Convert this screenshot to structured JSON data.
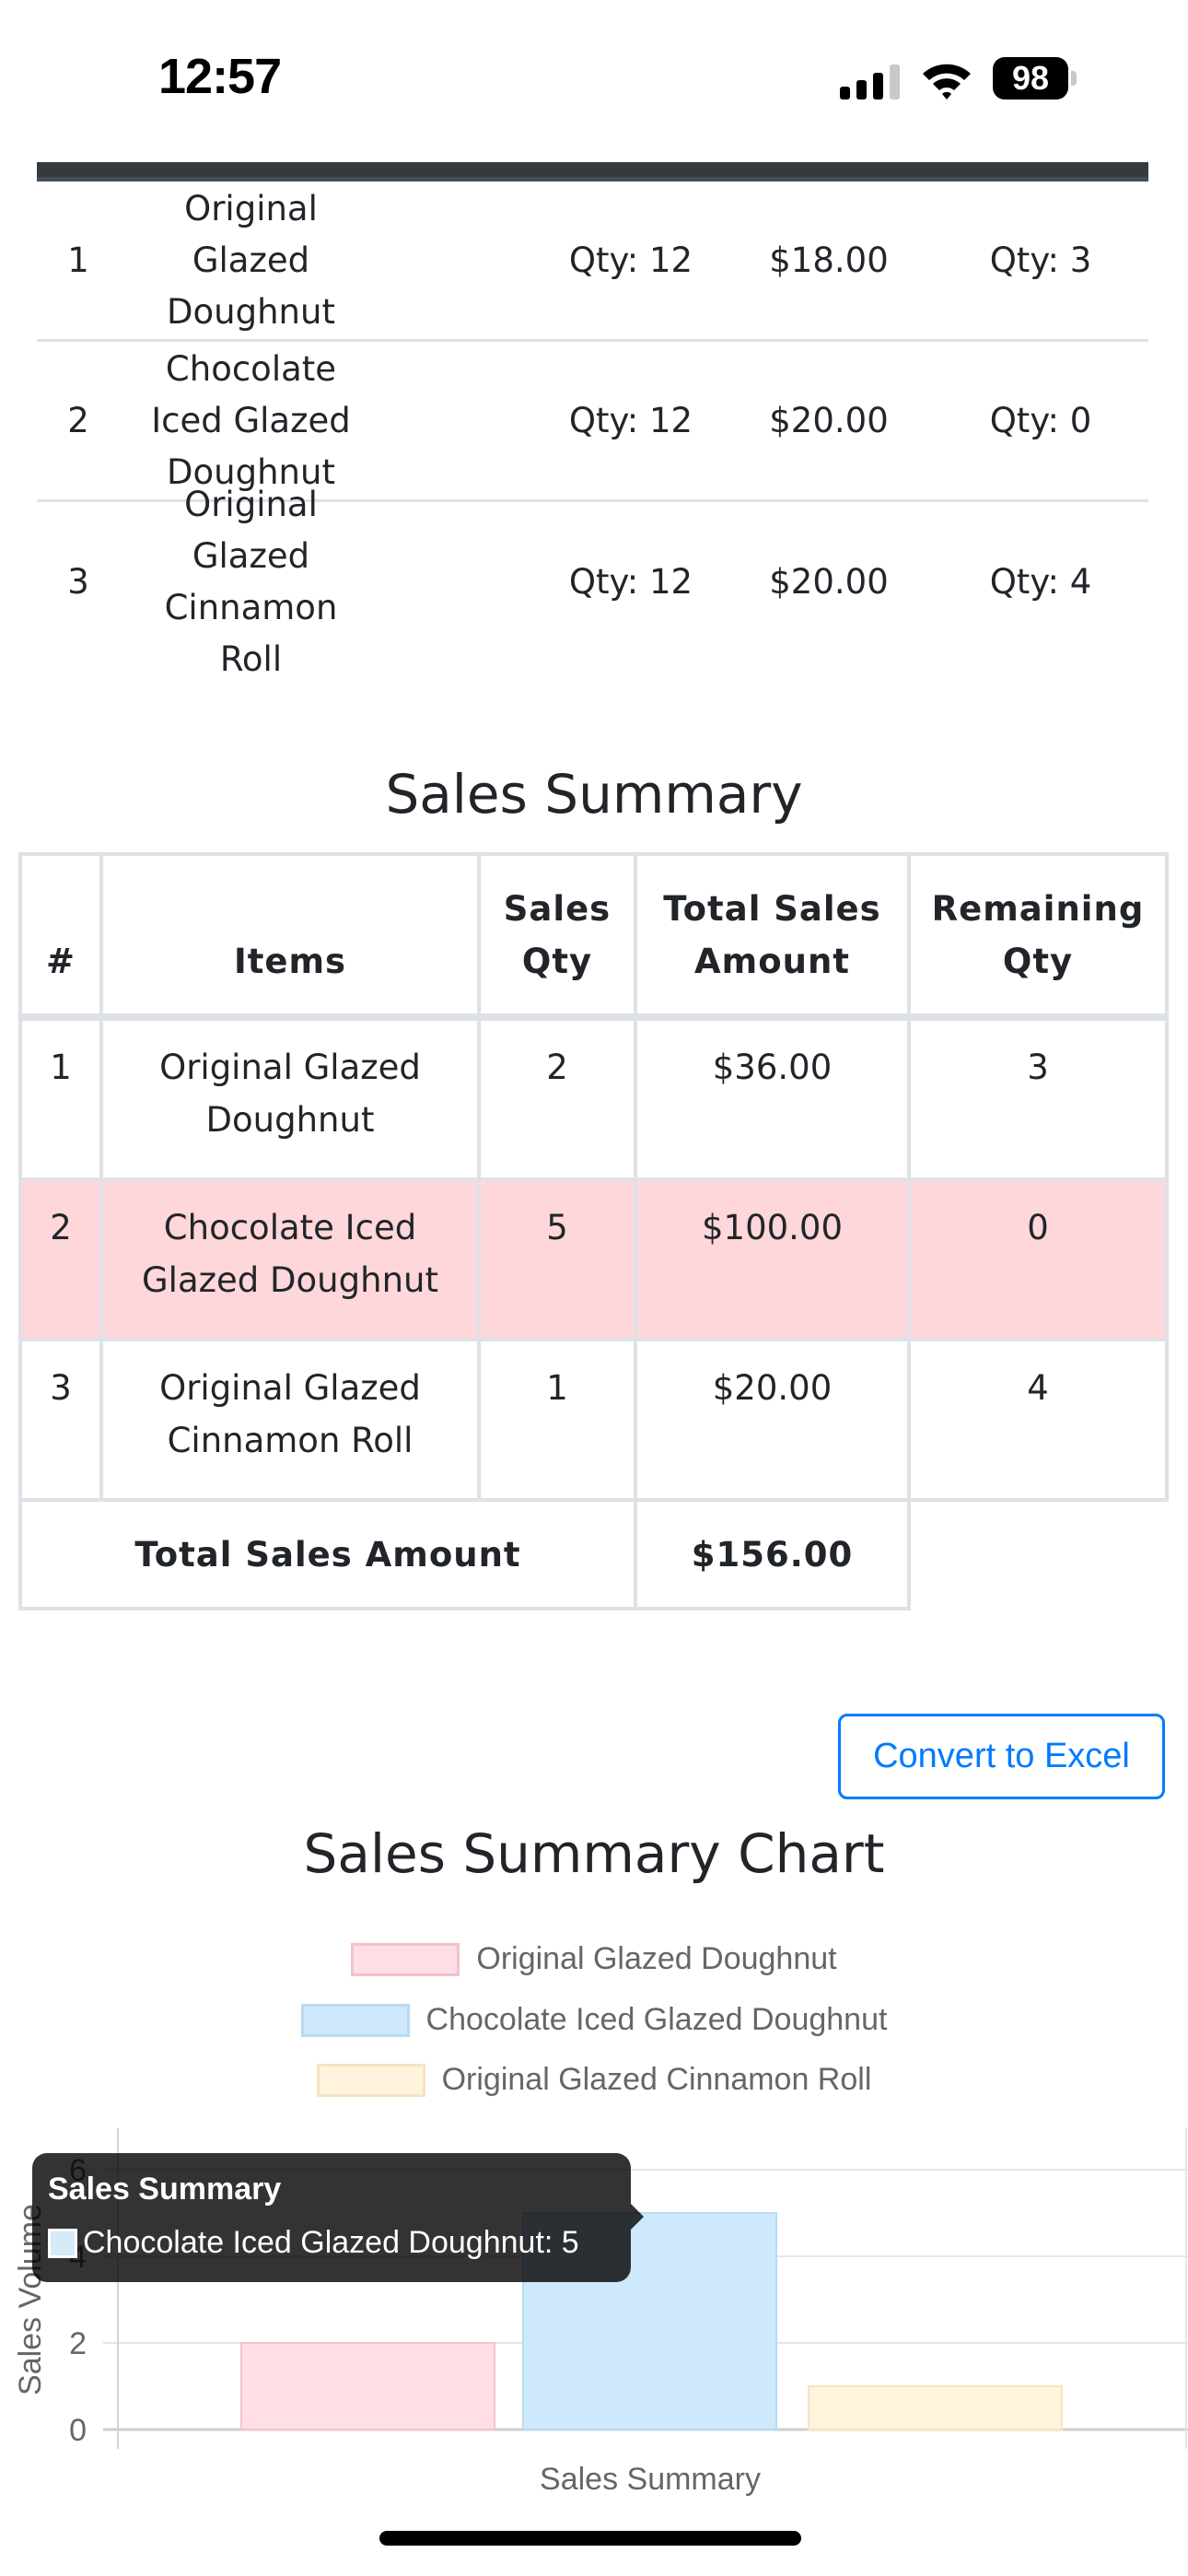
{
  "status_bar": {
    "time": "12:57",
    "battery_level": "98",
    "icons": [
      "cellular-signal-icon",
      "wifi-icon",
      "battery-icon"
    ]
  },
  "inventory_table": {
    "rows": [
      {
        "index": "1",
        "item": "Original Glazed Doughnut",
        "stock": "Qty: 12",
        "price": "$18.00",
        "remaining": "Qty: 3"
      },
      {
        "index": "2",
        "item": "Chocolate Iced Glazed Doughnut",
        "stock": "Qty: 12",
        "price": "$20.00",
        "remaining": "Qty: 0"
      },
      {
        "index": "3",
        "item": "Original Glazed Cinnamon Roll",
        "stock": "Qty: 12",
        "price": "$20.00",
        "remaining": "Qty: 4"
      }
    ]
  },
  "sales_summary": {
    "title": "Sales Summary",
    "headers": [
      "#",
      "Items",
      "Sales Qty",
      "Total Sales Amount",
      "Remaining Qty"
    ],
    "rows": [
      {
        "index": "1",
        "item": "Original Glazed Doughnut",
        "sales_qty": "2",
        "total": "$36.00",
        "remaining": "3",
        "highlight": false
      },
      {
        "index": "2",
        "item": "Chocolate Iced Glazed Doughnut",
        "sales_qty": "5",
        "total": "$100.00",
        "remaining": "0",
        "highlight": true
      },
      {
        "index": "3",
        "item": "Original Glazed Cinnamon Roll",
        "sales_qty": "1",
        "total": "$20.00",
        "remaining": "4",
        "highlight": false
      }
    ],
    "total_label": "Total Sales Amount",
    "total_value": "$156.00",
    "highlight_color": "#fed7da"
  },
  "actions": {
    "convert_to_excel": "Convert to Excel",
    "accent_color": "#007bff"
  },
  "chart_section": {
    "title": "Sales Summary Chart",
    "tooltip": {
      "title": "Sales Summary",
      "label": "Chocolate Iced Glazed Doughnut: 5",
      "swatch_color": "#d6eaf8"
    }
  },
  "chart_data": {
    "type": "bar",
    "title": "Sales Summary Chart",
    "categories": [
      "Sales Summary"
    ],
    "series": [
      {
        "name": "Original Glazed Doughnut",
        "values": [
          2
        ],
        "fill": "#ffdfe5",
        "border": "#f4c2cb"
      },
      {
        "name": "Chocolate Iced Glazed Doughnut",
        "values": [
          5
        ],
        "fill": "#cde9fb",
        "border": "#b7dbf3"
      },
      {
        "name": "Original Glazed Cinnamon Roll",
        "values": [
          1
        ],
        "fill": "#fff3dc",
        "border": "#f6e4c2"
      }
    ],
    "xlabel": "Sales Summary",
    "ylabel": "Sales Volume",
    "ylim": [
      0,
      6
    ],
    "yticks": [
      0,
      2,
      4,
      6
    ],
    "grid": true,
    "legend": "top-center"
  }
}
